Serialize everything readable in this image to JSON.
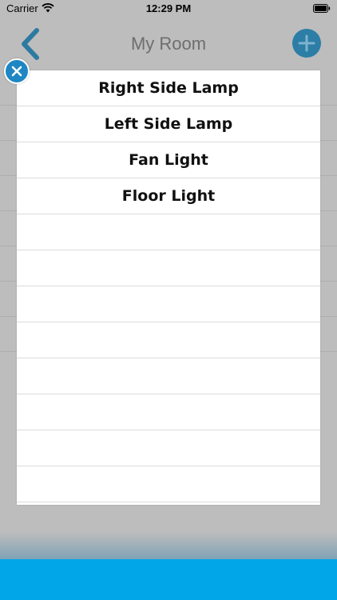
{
  "status_bar": {
    "carrier": "Carrier",
    "time": "12:29 PM",
    "wifi_icon": "wifi-icon",
    "battery_icon": "battery-icon"
  },
  "nav_bar": {
    "title": "My Room",
    "back_icon": "chevron-left-icon",
    "add_icon": "plus-circle-icon"
  },
  "popup": {
    "close_icon": "close-circle-icon",
    "options": [
      {
        "label": "Right Side Lamp"
      },
      {
        "label": "Left Side Lamp"
      },
      {
        "label": "Fan Light"
      },
      {
        "label": "Floor Light"
      }
    ]
  },
  "colors": {
    "accent": "#00a6e7",
    "close_button": "#1f86c4",
    "dim_overlay": "#bdbdbd"
  }
}
